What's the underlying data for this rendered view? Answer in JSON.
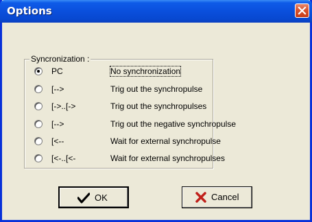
{
  "window": {
    "title": "Options"
  },
  "group": {
    "label": "Syncronization :"
  },
  "options": [
    {
      "code": "PC",
      "description": "No synchronization",
      "checked": true
    },
    {
      "code": "[-->",
      "description": "Trig out the synchropulse",
      "checked": false
    },
    {
      "code": "[->..[->",
      "description": "Trig out the synchropulses",
      "checked": false
    },
    {
      "code": "[-->",
      "description": "Trig out the negative synchropulse",
      "checked": false
    },
    {
      "code": "[<--",
      "description": "Wait for external synchropulse",
      "checked": false
    },
    {
      "code": "[<-..[<-",
      "description": "Wait for external synchropulses",
      "checked": false
    }
  ],
  "buttons": {
    "ok_label": "OK",
    "cancel_label": "Cancel"
  },
  "icons": {
    "close": "close-icon",
    "ok": "checkmark-icon",
    "cancel": "x-icon"
  },
  "colors": {
    "titlebar": "#0a4fdc",
    "close": "#d9532d",
    "checkmark": "#000000",
    "cancel_x": "#c0201a"
  }
}
